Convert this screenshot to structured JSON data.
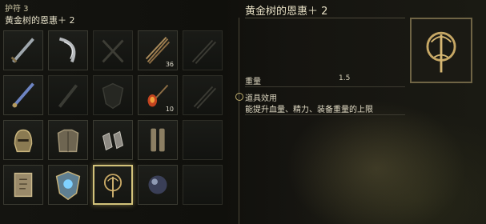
{
  "category": {
    "label": "护符 3"
  },
  "selected_item": {
    "name": "黄金树的恩惠＋ 2"
  },
  "grid": {
    "slots": [
      {
        "icon": "sword-talisman-icon",
        "quantity": ""
      },
      {
        "icon": "curved-blade-talisman-icon",
        "quantity": ""
      },
      {
        "icon": "crossed-axes-placeholder-icon",
        "quantity": ""
      },
      {
        "icon": "arrow-bundle-icon",
        "quantity": "36"
      },
      {
        "icon": "arrow-placeholder-icon",
        "quantity": ""
      },
      {
        "icon": "blue-sword-talisman-icon",
        "quantity": ""
      },
      {
        "icon": "blade-placeholder-icon",
        "quantity": ""
      },
      {
        "icon": "shield-placeholder-icon",
        "quantity": ""
      },
      {
        "icon": "fire-arrow-icon",
        "quantity": "10"
      },
      {
        "icon": "bolt-placeholder-icon",
        "quantity": ""
      },
      {
        "icon": "helmet-icon",
        "quantity": ""
      },
      {
        "icon": "chest-armor-icon",
        "quantity": ""
      },
      {
        "icon": "gauntlets-icon",
        "quantity": ""
      },
      {
        "icon": "greaves-icon",
        "quantity": ""
      },
      {
        "icon": "empty-slot",
        "quantity": ""
      },
      {
        "icon": "scroll-talisman-icon",
        "quantity": ""
      },
      {
        "icon": "blue-crest-shield-icon",
        "quantity": ""
      },
      {
        "icon": "golden-tree-talisman-icon",
        "quantity": ""
      },
      {
        "icon": "dark-orb-icon",
        "quantity": ""
      },
      {
        "icon": "empty-slot",
        "quantity": ""
      }
    ]
  },
  "detail": {
    "title": "黄金树的恩惠＋ 2",
    "weight_label": "重量",
    "weight_value": "1.5",
    "effect_heading": "道具效用",
    "effect_text": "能提升血量、精力、装备重量的上限"
  },
  "colors": {
    "accent": "#d2c27a",
    "panel_border": "#3a3a31"
  }
}
